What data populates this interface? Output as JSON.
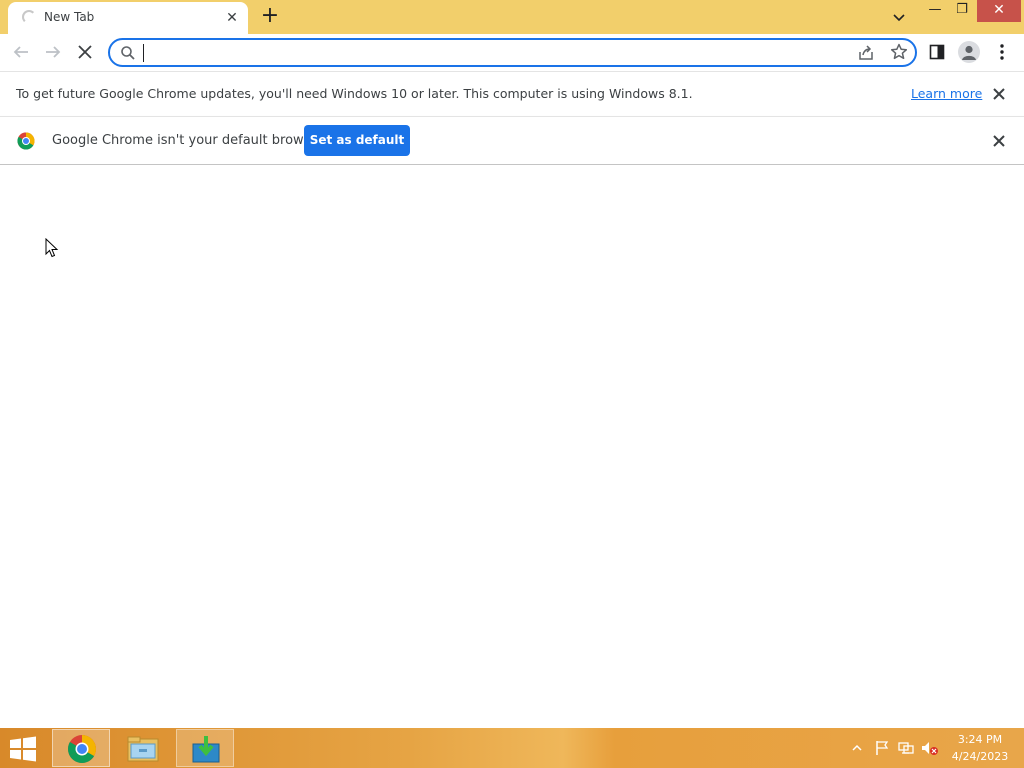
{
  "tab": {
    "title": "New Tab",
    "close_glyph": "✕",
    "new_tab_glyph": "+"
  },
  "window": {
    "minimize_glyph": "—",
    "maximize_glyph": "❐",
    "close_glyph": "✕"
  },
  "toolbar": {
    "omnibox_value": ""
  },
  "infobar_update": {
    "text": "To get future Google Chrome updates, you'll need Windows 10 or later. This computer is using Windows 8.1.",
    "link": "Learn more"
  },
  "infobar_default": {
    "text": "Google Chrome isn't your default browser",
    "button": "Set as default"
  },
  "taskbar": {
    "time": "3:24 PM",
    "date": "4/24/2023",
    "apps": [
      "chrome-icon",
      "file-explorer-icon",
      "store-icon"
    ]
  },
  "colors": {
    "tabstrip": "#f2cf6b",
    "accent": "#1a73e8",
    "close_red": "#c7524a",
    "taskbar": "#e6a444"
  }
}
